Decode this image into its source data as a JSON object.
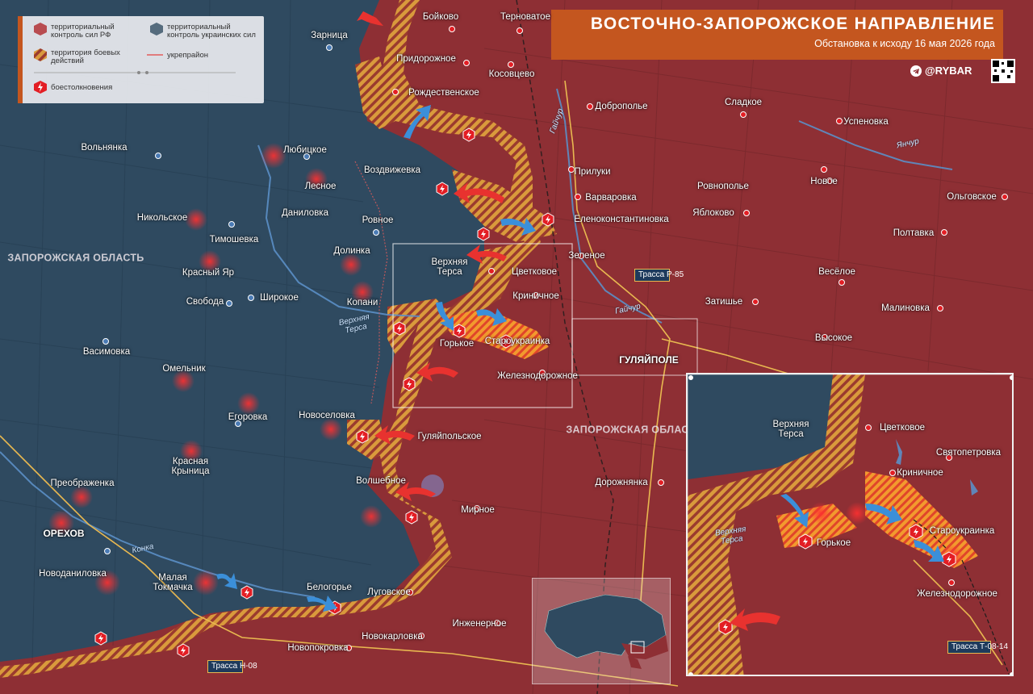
{
  "title": {
    "main": "ВОСТОЧНО-ЗАПОРОЖСКОЕ НАПРАВЛЕНИЕ",
    "subtitle": "Обстановка к исходу 16 мая 2026 года"
  },
  "brand": {
    "name": "@RYBAR",
    "icon": "telegram-icon"
  },
  "legend": {
    "rf_control": "территориальный контроль сил РФ",
    "ua_control": "территориальный контроль украинских сил",
    "combat_zone": "территория боевых действий",
    "fortified": "укрепрайон",
    "clashes": "боестолкновения"
  },
  "regions": {
    "zap_west": "ЗАПОРОЖСКАЯ ОБЛАСТЬ",
    "zap_east": "ЗАПОРОЖСКАЯ ОБЛАСТЬ"
  },
  "rivers": {
    "gaichur1": "Гайчур",
    "gaichur2": "Гайчур",
    "yanchur": "Янчур",
    "konka": "Конка",
    "verkhnyaya_tersa": "Верхняя Терса",
    "inset_tersa": "Верхняя Терса"
  },
  "roads": {
    "r85": "Трасса Р-85",
    "h08": "Трасса Н-08",
    "t0814": "Трасса Т-08-14"
  },
  "towns": {
    "zarnitsa": "Зарница",
    "boykovo": "Бойково",
    "ternovatoe": "Терноватое",
    "pridorozhnoe": "Придорожное",
    "kosovtsevo": "Косовцево",
    "rozhdestvenskoe": "Рождественское",
    "dobropolye": "Доброполье",
    "sladkoe": "Сладкое",
    "uspenovka": "Успеновка",
    "volnyanka": "Вольнянка",
    "lyubitskoe": "Любицкое",
    "vozdvizhevka": "Воздвижевка",
    "lesnoe": "Лесное",
    "prilukki": "Прилуки",
    "varvarovka": "Варваровка",
    "rovnopolye": "Ровнополье",
    "novoe": "Новое",
    "olgovskoe": "Ольговское",
    "nikolskoe": "Никольское",
    "danilovka": "Даниловка",
    "rovnoe": "Ровное",
    "elenokonst": "Еленоконстантиновка",
    "yablokovo": "Яблоково",
    "timoshevka": "Тимошевка",
    "poltavka": "Полтавка",
    "dolinka": "Долинка",
    "zelenoe": "Зеленое",
    "krasny_yar": "Красный Яр",
    "verkhnyaya_tersa": "Верхняя Терса",
    "tsvetkovoe": "Цветковое",
    "veseloe": "Весёлое",
    "svoboda": "Свобода",
    "shirokoe": "Широкое",
    "kopani": "Копани",
    "krinichnoe": "Криничное",
    "zatishye": "Затишье",
    "malinovka": "Малиновка",
    "vasimovka": "Васимовка",
    "gorkoe": "Горькое",
    "staroukrainka": "Староукраинка",
    "vysokoe": "Высокое",
    "gulyaipole": "ГУЛЯЙПОЛЕ",
    "omelnik": "Омельник",
    "zheleznodorozhnoe": "Железнодорожное",
    "egorovka": "Егоровка",
    "novoselovka": "Новоселовка",
    "gulyaipolskoe": "Гуляйпольское",
    "krasnaya_krinitsa": "Красная Крыница",
    "preobrazhenka": "Преображенка",
    "volshebnoe": "Волшебное",
    "dorozhnyanka": "Дорожнянка",
    "mirnoe": "Мирное",
    "orekhov": "ОРЕХОВ",
    "novodanilovka": "Новоданиловка",
    "malaya_tokmachka": "Малая Токмачка",
    "belogorye": "Белогорье",
    "lugovskoe": "Луговское",
    "inzhenernoe": "Инженерное",
    "novokarlovka": "Новокарловка",
    "novopokrovka": "Новопокровка"
  },
  "inset": {
    "verkhnyaya_tersa": "Верхняя Терса",
    "tsvetkovoe": "Цветковое",
    "svyatopetrovka": "Святопетровка",
    "krinichnoe": "Криничное",
    "gorkoe": "Горькое",
    "staroukrainka": "Староукраинка",
    "zheleznodorozhnoe": "Железнодорожное"
  },
  "colors": {
    "rf": "#8e2f34",
    "ua": "#2f4a60",
    "combat": "#e39a3a",
    "accent": "#c4561f"
  }
}
